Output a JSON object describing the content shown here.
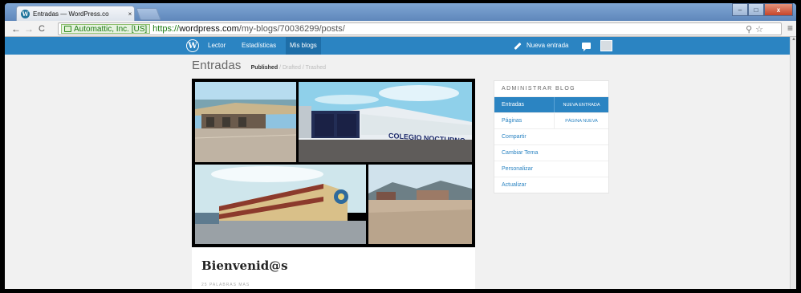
{
  "browser": {
    "tab_title": "Entradas — WordPress.co",
    "tab_close": "×",
    "favicon": "W",
    "window_min": "–",
    "window_max": "□",
    "window_close": "x",
    "back_glyph": "←",
    "forward_glyph": "→",
    "reload_glyph": "C",
    "ev_label": "Automattic, Inc. [US]",
    "url_scheme": "https://",
    "url_host": "wordpress.com",
    "url_path": "/my-blogs/70036299/posts/",
    "search_icon": "⚲",
    "star_icon": "☆",
    "menu_icon": "≡"
  },
  "masterbar": {
    "logo": "W",
    "links": [
      "Lector",
      "Estadísticas",
      "Mis blogs"
    ],
    "active_index": 2,
    "new_post": "Nueva entrada",
    "accent": "#2b84c2"
  },
  "page": {
    "title": "Entradas",
    "filter_published": "Published",
    "filter_sep": "/",
    "filter_drafted": "Drafted",
    "filter_trashed": "Trashed"
  },
  "post": {
    "title": "Bienvenid@s",
    "meta": "25 PALABRAS MAS",
    "photo_sign": "COLEGIO NOCTURNO"
  },
  "sidebar": {
    "heading": "ADMINISTRAR BLOG",
    "rows": [
      {
        "label": "Entradas",
        "side": "NUEVA ENTRADA"
      },
      {
        "label": "Páginas",
        "side": "PÁGINA NUEVA"
      },
      {
        "label": "Compartir"
      },
      {
        "label": "Cambiar Tema"
      },
      {
        "label": "Personalizar"
      },
      {
        "label": "Actualizar"
      }
    ]
  },
  "icons": [
    "wordpress-icon",
    "lock-icon",
    "search-icon",
    "star-icon",
    "menu-icon",
    "pencil-icon",
    "notifications-icon",
    "avatar"
  ]
}
